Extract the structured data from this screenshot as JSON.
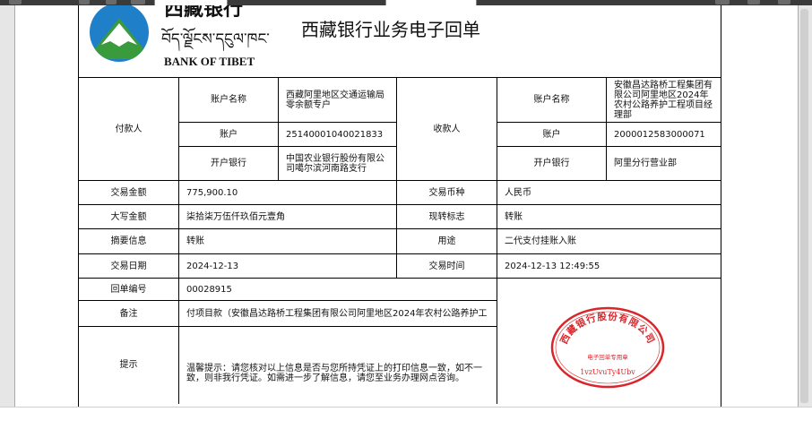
{
  "bank": {
    "name_cn": "西藏银行",
    "name_tibetan": "བོད་ལྗོངས་དངུལ་ཁང་",
    "name_en": "BANK OF TIBET"
  },
  "title": "西藏银行业务电子回单",
  "payer": {
    "section_label": "付款人",
    "account_name_label": "账户名称",
    "account_name": "西藏阿里地区交通运输局零余额专户",
    "account_label": "账户",
    "account": "25140001040021833",
    "bank_label": "开户银行",
    "bank": "中国农业银行股份有限公司噶尔滨河南路支行"
  },
  "payee": {
    "section_label": "收款人",
    "account_name_label": "账户名称",
    "account_name": "安徽昌达路桥工程集团有限公司阿里地区2024年农村公路养护工程项目经理部",
    "account_label": "账户",
    "account": "2000012583000071",
    "bank_label": "开户银行",
    "bank": "阿里分行营业部"
  },
  "details": {
    "amount_label": "交易金额",
    "amount": "775,900.10",
    "currency_label": "交易币种",
    "currency": "人民币",
    "amount_words_label": "大写金额",
    "amount_words": "柒拾柒万伍仟玖佰元壹角",
    "transfer_flag_label": "现转标志",
    "transfer_flag": "转账",
    "summary_label": "摘要信息",
    "summary": "转账",
    "purpose_label": "用途",
    "purpose": "二代支付挂账入账",
    "date_label": "交易日期",
    "date": "2024-12-13",
    "time_label": "交易时间",
    "time": "2024-12-13 12:49:55",
    "receipt_no_label": "回单编号",
    "receipt_no": "00028915",
    "remark_label": "备注",
    "remark": "付项目款（安徽昌达路桥工程集团有限公司阿里地区2024年农村公路养护工",
    "tip_label": "提示",
    "tip": "温馨提示：请您核对以上信息是否与您所持凭证上的打印信息一致，如不一致，则非我行凭证。如需进一步了解信息，请您至业务办理网点咨询。"
  },
  "seal": {
    "ring_text": "西藏银行股份有限公司",
    "center_text": "电子回单专用章",
    "code": "1vzUvuTy4Ubv"
  },
  "colors": {
    "seal_red": "#d8262b",
    "logo_blue": "#1f7fc8",
    "logo_green": "#3a9b3d"
  }
}
